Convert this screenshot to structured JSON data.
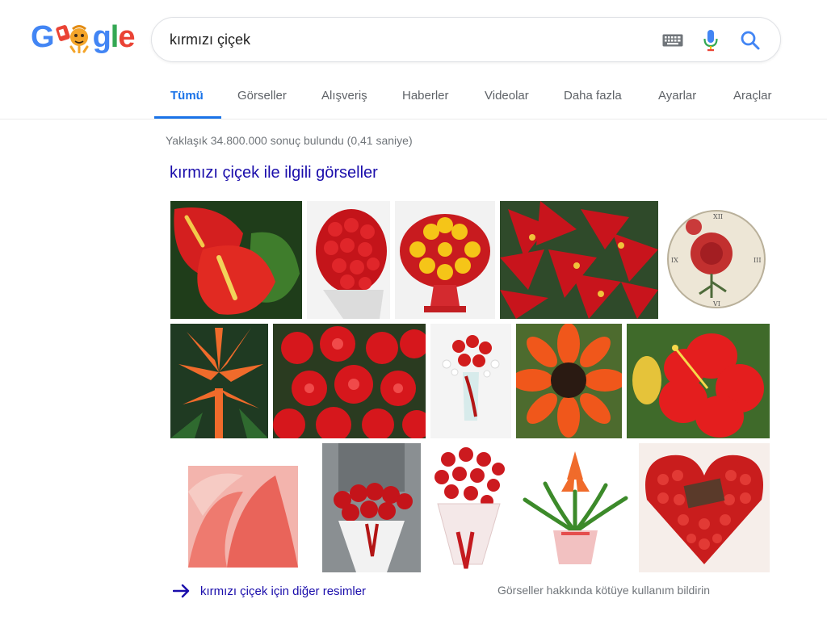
{
  "logo": {
    "letters": [
      "G",
      "g",
      "l",
      "e"
    ]
  },
  "search": {
    "query": "kırmızı çiçek"
  },
  "icons": {
    "keyboard": "keyboard-icon",
    "mic": "mic-icon",
    "search": "search-icon",
    "arrow": "arrow-right-icon"
  },
  "tabs": [
    {
      "label": "Tümü",
      "active": true
    },
    {
      "label": "Görseller",
      "active": false
    },
    {
      "label": "Alışveriş",
      "active": false
    },
    {
      "label": "Haberler",
      "active": false
    },
    {
      "label": "Videolar",
      "active": false
    },
    {
      "label": "Daha fazla",
      "active": false
    },
    {
      "label": "Ayarlar",
      "active": false
    },
    {
      "label": "Araçlar",
      "active": false
    }
  ],
  "results": {
    "stats": "Yaklaşık 34.800.000 sonuç bulundu (0,41 saniye)",
    "images_heading": "kırmızı çiçek ile ilgili görseller",
    "more_images": "kırmızı çiçek için diğer resimler",
    "report": "Görseller hakkında kötüye kullanım bildirin"
  },
  "colors": {
    "accent_blue": "#1a73e8",
    "link": "#1a0dab",
    "muted": "#70757a",
    "tab_text": "#5f6368"
  }
}
